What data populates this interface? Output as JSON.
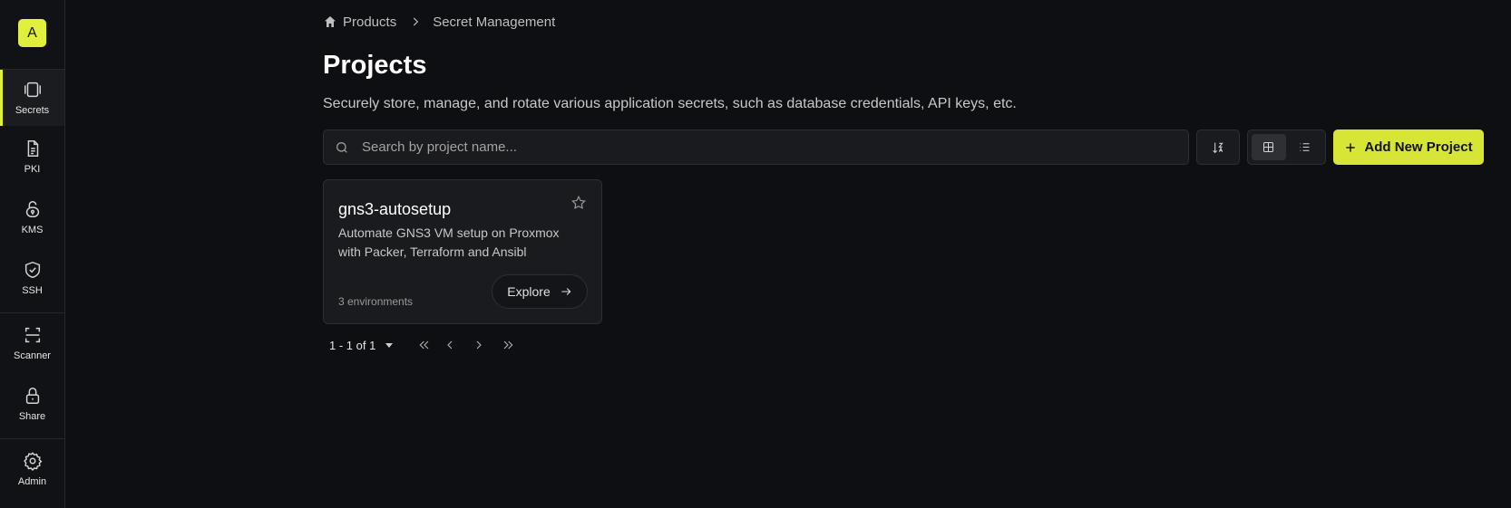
{
  "sidebar": {
    "org_initial": "A",
    "items": [
      {
        "label": "Secrets",
        "icon": "vault-icon",
        "active": true
      },
      {
        "label": "PKI",
        "icon": "document-icon"
      },
      {
        "label": "KMS",
        "icon": "lock-key-icon"
      },
      {
        "label": "SSH",
        "icon": "shield-check-icon"
      },
      {
        "label": "Scanner",
        "icon": "scan-icon"
      },
      {
        "label": "Share",
        "icon": "lock-icon"
      },
      {
        "label": "Admin",
        "icon": "gear-icon"
      }
    ]
  },
  "breadcrumb": {
    "items": [
      "Products",
      "Secret Management"
    ]
  },
  "page": {
    "title": "Projects",
    "description": "Securely store, manage, and rotate various application secrets, such as database credentials, API keys, etc."
  },
  "toolbar": {
    "search_placeholder": "Search by project name...",
    "add_label": "Add New Project",
    "view_mode": "grid"
  },
  "projects": [
    {
      "name": "gns3-autosetup",
      "description": "Automate GNS3 VM setup on Proxmox with Packer, Terraform and Ansibl",
      "environments": "3 environments",
      "action_label": "Explore"
    }
  ],
  "pagination": {
    "range": "1 - 1 of 1"
  },
  "colors": {
    "accent": "#e1f03c",
    "background": "#0e0f12",
    "card": "#1a1b1e"
  }
}
